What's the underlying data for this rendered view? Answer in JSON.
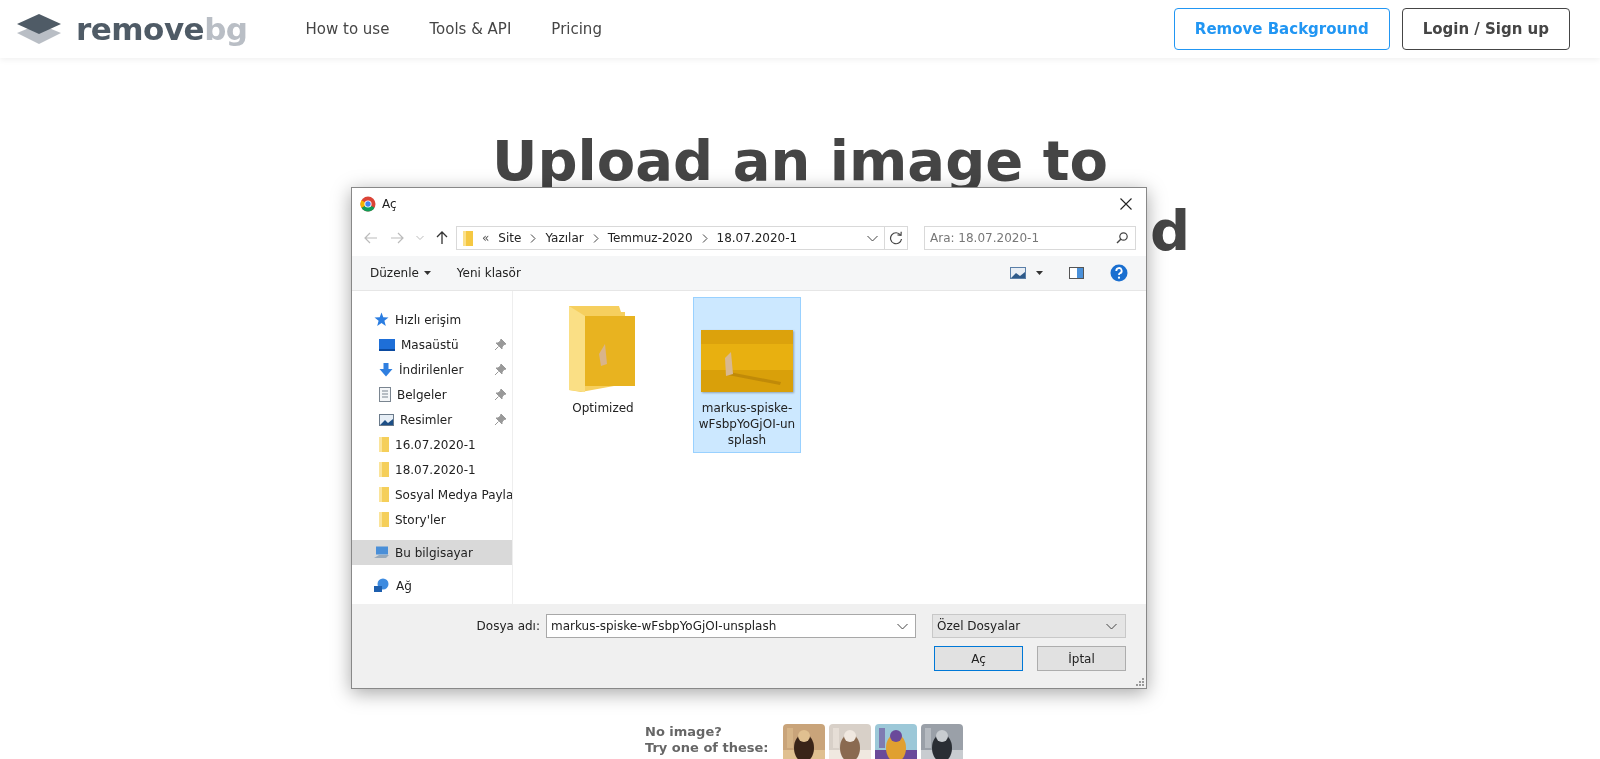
{
  "header": {
    "logo": {
      "main": "remove",
      "accent": "bg"
    },
    "nav": [
      "How to use",
      "Tools & API",
      "Pricing"
    ],
    "buttons": [
      {
        "label": "Remove Background",
        "kind": "primary"
      },
      {
        "label": "Login / Sign up",
        "kind": "plain"
      }
    ]
  },
  "hero": {
    "title_line_1": "Upload an image to",
    "title_line_2_visible": "d"
  },
  "dialog": {
    "title": "Aç",
    "address": {
      "overflow_mark": "«",
      "path": [
        "Site",
        "Yazılar",
        "Temmuz-2020",
        "18.07.2020-1"
      ]
    },
    "search": {
      "placeholder": "Ara: 18.07.2020-1"
    },
    "toolbar": [
      {
        "label": "Düzenle",
        "dropdown": true
      },
      {
        "label": "Yeni klasör",
        "dropdown": false
      }
    ],
    "sidebar": [
      {
        "label": "Hızlı erişim",
        "kind": "star",
        "selected": false,
        "children": [
          {
            "label": "Masaüstü",
            "kind": "desktop",
            "pinned": true,
            "selected": false
          },
          {
            "label": "İndirilenler",
            "kind": "download",
            "pinned": true,
            "selected": false
          },
          {
            "label": "Belgeler",
            "kind": "document",
            "pinned": true,
            "selected": false
          },
          {
            "label": "Resimler",
            "kind": "pictures",
            "pinned": true,
            "selected": false
          },
          {
            "label": "16.07.2020-1",
            "kind": "folder",
            "pinned": false,
            "selected": false
          },
          {
            "label": "18.07.2020-1",
            "kind": "folder",
            "pinned": false,
            "selected": false
          },
          {
            "label": "Sosyal Medya Payla",
            "kind": "folder",
            "pinned": false,
            "selected": false
          },
          {
            "label": "Story'ler",
            "kind": "folder",
            "pinned": false,
            "selected": false
          }
        ]
      },
      {
        "label": "Bu bilgisayar",
        "kind": "computer",
        "selected": true
      },
      {
        "label": "Ağ",
        "kind": "network",
        "selected": false
      }
    ],
    "files": [
      {
        "name": "Optimized",
        "kind": "folder",
        "selected": false
      },
      {
        "name": "markus-spiske-wFsbpYoGjOI-unsplash",
        "selected": true
      }
    ],
    "filename_label": "Dosya adı:",
    "filename_value": "markus-spiske-wFsbpYoGjOI-unsplash",
    "filetype": "Özel Dosyalar",
    "buttons": [
      {
        "label": "Aç",
        "kind": "default"
      },
      {
        "label": "İptal",
        "kind": "normal"
      }
    ]
  },
  "samples": {
    "lines": [
      "No image?",
      "Try one of these:"
    ],
    "thumbnails": [
      {
        "kind": "picture"
      },
      {
        "kind": "picture"
      },
      {
        "kind": "picture"
      },
      {
        "kind": "picture"
      }
    ]
  }
}
